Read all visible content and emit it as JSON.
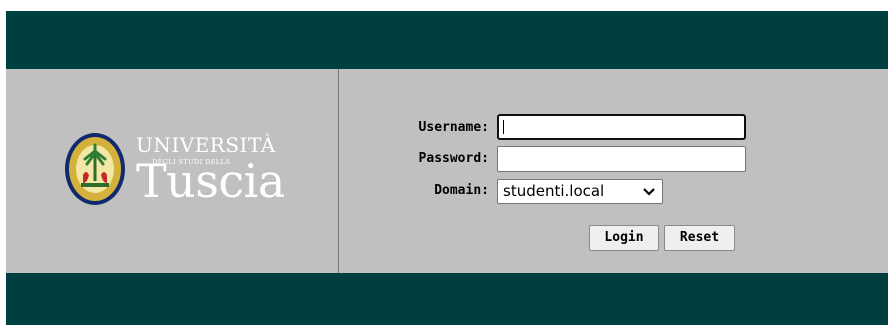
{
  "logo": {
    "line1": "UNIVERSITÀ",
    "line2": "DEGLI STUDI DELLA",
    "line3": "Tuscia",
    "seal_icon": "university-seal-icon"
  },
  "form": {
    "username_label": "Username:",
    "username_value": "",
    "password_label": "Password:",
    "password_value": "",
    "domain_label": "Domain:",
    "domain_selected": "studenti.local",
    "login_label": "Login",
    "reset_label": "Reset"
  },
  "colors": {
    "frame": "#003f3f",
    "panel": "#c0c0c0"
  }
}
